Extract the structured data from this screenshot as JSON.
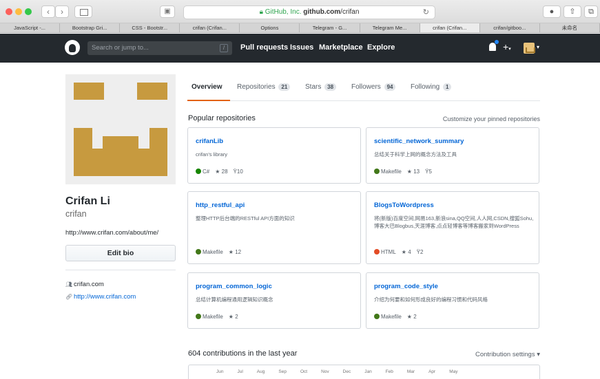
{
  "browser": {
    "address_host_prefix": "GitHub, Inc.",
    "address_domain": "github.com",
    "address_path": "/crifan",
    "tabs": [
      {
        "label": "JavaScript -..."
      },
      {
        "label": "Bootstrap Gri..."
      },
      {
        "label": "CSS - Bootstr..."
      },
      {
        "label": "crifan (Crifan..."
      },
      {
        "label": "Options"
      },
      {
        "label": "Telegram - G..."
      },
      {
        "label": "Telegram Me..."
      },
      {
        "label": "crifan (Crifan..."
      },
      {
        "label": "crifan/gitboo..."
      },
      {
        "label": "未命名"
      }
    ],
    "active_tab_index": 7
  },
  "header": {
    "search_placeholder": "Search or jump to...",
    "slash_hint": "/",
    "nav": [
      "Pull requests",
      "Issues",
      "Marketplace",
      "Explore"
    ],
    "plus_symbol": "+"
  },
  "profile": {
    "name": "Crifan Li",
    "login": "crifan",
    "bio": "http://www.crifan.com/about/me/",
    "edit_bio_label": "Edit bio",
    "organization": "crifan.com",
    "blog_link": "http://www.crifan.com",
    "avatar_color": "#c79a3f"
  },
  "profile_tabs": {
    "overview": "Overview",
    "repositories": "Repositories",
    "repositories_count": "21",
    "stars": "Stars",
    "stars_count": "38",
    "followers": "Followers",
    "followers_count": "94",
    "following": "Following",
    "following_count": "1"
  },
  "popular": {
    "title": "Popular repositories",
    "customize_label": "Customize your pinned repositories",
    "repos": [
      {
        "name": "crifanLib",
        "desc": "crifan's library",
        "lang": "C#",
        "lang_color": "#178600",
        "stars": "28",
        "forks": "10"
      },
      {
        "name": "scientific_network_summary",
        "desc": "总结关于科学上网的概念方法及工具",
        "lang": "Makefile",
        "lang_color": "#427819",
        "stars": "13",
        "forks": "5"
      },
      {
        "name": "http_restful_api",
        "desc": "整理HTTP后台端的RESTful API方面的知识",
        "lang": "Makefile",
        "lang_color": "#427819",
        "stars": "12",
        "forks": ""
      },
      {
        "name": "BlogsToWordpress",
        "desc": "将(新版)百度空间,网易163,新浪sina,QQ空间,人人网,CSDN,搜狐Sohu,博客大巴Blogbus,天涯博客,点点轻博客等博客搬家到WordPress",
        "lang": "HTML",
        "lang_color": "#e34c26",
        "stars": "4",
        "forks": "2"
      },
      {
        "name": "program_common_logic",
        "desc": "总结计算机编程通用逻辑知识概念",
        "lang": "Makefile",
        "lang_color": "#427819",
        "stars": "2",
        "forks": ""
      },
      {
        "name": "program_code_style",
        "desc": "介绍为何要和如何形成良好的编程习惯和代码风格",
        "lang": "Makefile",
        "lang_color": "#427819",
        "stars": "2",
        "forks": ""
      }
    ]
  },
  "contributions": {
    "title": "604 contributions in the last year",
    "settings_label": "Contribution settings",
    "months": [
      "Jun",
      "Jul",
      "Aug",
      "Sep",
      "Oct",
      "Nov",
      "Dec",
      "Jan",
      "Feb",
      "Mar",
      "Apr",
      "May"
    ]
  }
}
